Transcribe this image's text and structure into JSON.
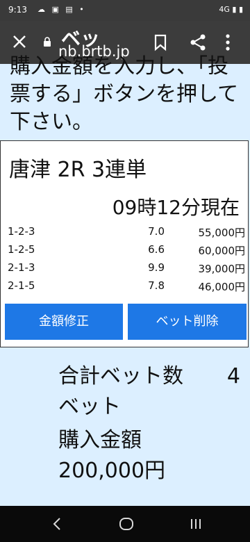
{
  "status_bar": {
    "time": "9:13",
    "left_icons": "☁ ▣ ▤ •",
    "right_icons": "4G ▮ ▮"
  },
  "toolbar": {
    "site_title": "ベッ",
    "url": "nb.brtb.jp"
  },
  "instructions": "購入金額を入力し、「投票する」ボタンを押して下さい。",
  "bet_card": {
    "race_title": "唐津 2R 3連単",
    "odds_time": "09時12分現在",
    "rows": [
      {
        "combo": "1-2-3",
        "odds": "7.0",
        "amount": "55,000円"
      },
      {
        "combo": "1-2-5",
        "odds": "6.6",
        "amount": "60,000円"
      },
      {
        "combo": "2-1-3",
        "odds": "9.9",
        "amount": "39,000円"
      },
      {
        "combo": "2-1-5",
        "odds": "7.8",
        "amount": "46,000円"
      }
    ],
    "edit_label": "金額修正",
    "delete_label": "ベット削除"
  },
  "summary": {
    "total_label": "合計ベット数",
    "total_count": "4",
    "unit": "ベット",
    "purchase_label": "購入金額",
    "purchase_amount": "200,000円"
  },
  "colors": {
    "page_bg": "#dcefff",
    "button_blue": "#1e78e6",
    "toolbar_bg": "#3c3c3c"
  }
}
